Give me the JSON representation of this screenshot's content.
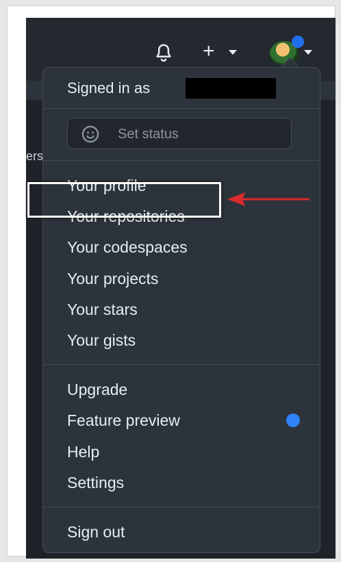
{
  "header": {
    "notifications_icon": "bell-icon",
    "create_icon": "plus-icon",
    "avatar_icon": "avatar"
  },
  "background": {
    "partial_text": "ers"
  },
  "menu": {
    "signed_in_label": "Signed in as",
    "status": {
      "icon": "smiley-icon",
      "label": "Set status"
    },
    "section1": [
      "Your profile",
      "Your repositories",
      "Your codespaces",
      "Your projects",
      "Your stars",
      "Your gists"
    ],
    "section2": [
      "Upgrade",
      "Feature preview",
      "Help",
      "Settings"
    ],
    "sign_out": "Sign out"
  },
  "annotation": {
    "highlighted_item": "Your repositories",
    "arrow_color": "#d92b2b",
    "highlight_color": "#ffffff"
  },
  "colors": {
    "menu_bg": "#2d333b",
    "accent_blue": "#2f81f7"
  }
}
